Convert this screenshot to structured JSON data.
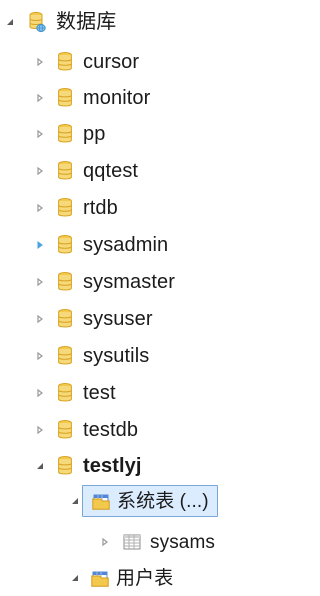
{
  "tree": {
    "root": {
      "label": "数据库",
      "icon": "database-root-icon",
      "expanded": true
    },
    "items": [
      {
        "label": "cursor",
        "icon": "database-icon",
        "expanded": false
      },
      {
        "label": "monitor",
        "icon": "database-icon",
        "expanded": false
      },
      {
        "label": "pp",
        "icon": "database-icon",
        "expanded": false
      },
      {
        "label": "qqtest",
        "icon": "database-icon",
        "expanded": false
      },
      {
        "label": "rtdb",
        "icon": "database-icon",
        "expanded": false
      },
      {
        "label": "sysadmin",
        "icon": "database-icon",
        "expanded": false,
        "hovered": true
      },
      {
        "label": "sysmaster",
        "icon": "database-icon",
        "expanded": false
      },
      {
        "label": "sysuser",
        "icon": "database-icon",
        "expanded": false
      },
      {
        "label": "sysutils",
        "icon": "database-icon",
        "expanded": false
      },
      {
        "label": "test",
        "icon": "database-icon",
        "expanded": false
      },
      {
        "label": "testdb",
        "icon": "database-icon",
        "expanded": false
      },
      {
        "label": "testlyj",
        "icon": "database-icon",
        "expanded": true,
        "bold": true
      }
    ],
    "testlyj_children": [
      {
        "label": "系统表 (...)",
        "icon": "table-folder-icon",
        "expanded": true,
        "selected": true
      },
      {
        "label": "sysams",
        "icon": "table-icon",
        "expanded": false
      },
      {
        "label": "用户表",
        "icon": "table-folder-icon",
        "expanded": true
      }
    ]
  },
  "colors": {
    "text": "#1b1b1b",
    "arrow_gray": "#9a9a9a",
    "arrow_blue": "#4aa3df",
    "expanded_arrow": "#5a5a5a",
    "db_yellow": "#f2c94c",
    "db_orange": "#d8a31f",
    "selection_fill": "#dcecff",
    "selection_border": "#7aa7d8"
  }
}
